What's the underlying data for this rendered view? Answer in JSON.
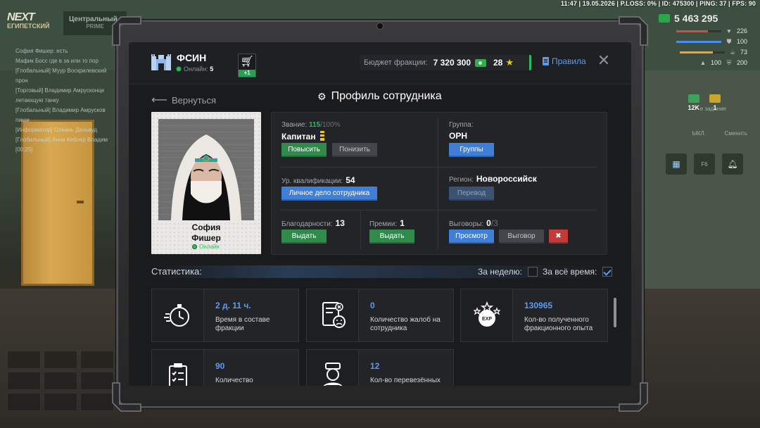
{
  "hud": {
    "top_status": "11:47 | 19.05.2026 | P.LOSS: 0% | ID: 475300 | PING: 37 | FPS: 90",
    "logo_top": "NEXT",
    "logo_sub": "ЕГИПЕТСКИЙ",
    "server_name": "Центральный",
    "server_tag": "PRIME",
    "money": "5 463 295",
    "stats": [
      {
        "value": "226",
        "fill": 0.7,
        "color": "#e0463e",
        "icon": "heart-icon"
      },
      {
        "value": "100",
        "fill": 1.0,
        "color": "#4a8df0",
        "icon": "armor-icon"
      },
      {
        "value": "73",
        "fill": 0.73,
        "color": "#f0a13a",
        "icon": "food-icon"
      },
      {
        "value": "100",
        "fill": 1.0,
        "color": "#9a9a9a",
        "icon": "wanted-icon"
      },
      {
        "value": "200",
        "fill": 1.0,
        "color": "#9a9a9a",
        "icon": "shield-icon"
      }
    ],
    "task_text": "е задание",
    "mini_cash_a": "12K",
    "mini_cash_b": "1",
    "swap_left": "ЫКЛ.",
    "swap_right": "Сменить",
    "chat_lines": [
      "София Фишер: есть",
      "Мафик Босс где в за или то пор",
      "[Глобальный] Муур Воскрилевский",
      "прон",
      "[Торговый] Владимир Амрусконце",
      "летающую танку",
      "[Глобальный] Владимир Амрусков",
      "пиши",
      "[Информатор] Олеань Деньвуд",
      "[Глобальный] Анна Кеблер Владим",
      "[00:25]"
    ]
  },
  "header": {
    "faction_name": "ФСИН",
    "online_label": "Онлайн:",
    "online_count": "5",
    "cart_badge": "+1",
    "budget_label": "Бюджет фракции:",
    "budget_value": "7 320 300",
    "stars_value": "28",
    "rules_label": "Правила"
  },
  "nav": {
    "back_label": "Вернуться",
    "title": "Профиль сотрудника"
  },
  "employee": {
    "first_name": "София",
    "last_name": "Фишер",
    "status": "Онлайн"
  },
  "info": {
    "rank_label": "Звание:",
    "rank_current": "115",
    "rank_max": "/100%",
    "rank_name": "Капитан",
    "promote": "Повысить",
    "demote": "Понизить",
    "group_label": "Группа:",
    "group_value": "ОРН",
    "groups_btn": "Группы",
    "qual_label": "Ур. квалификации:",
    "qual_value": "54",
    "file_btn": "Личное дело сотрудника",
    "region_label": "Регион:",
    "region_value": "Новороссийск",
    "transfer_btn": "Перевод",
    "thanks_label": "Благодарности:",
    "thanks_value": "13",
    "thanks_btn": "Выдать",
    "bonus_label": "Премии:",
    "bonus_value": "1",
    "bonus_btn": "Выдать",
    "reprimand_label": "Выговоры:",
    "reprimand_value": "0",
    "reprimand_max": "/3",
    "view_btn": "Просмотр",
    "reprimand_btn": "Выговор"
  },
  "stats": {
    "label": "Статистика:",
    "week_label": "За неделю:",
    "all_label": "За всё время:",
    "week_checked": false,
    "all_checked": true,
    "cards": [
      {
        "value": "2 д. 11 ч.",
        "desc": "Время в составе фракции",
        "icon": "stopwatch-icon"
      },
      {
        "value": "0",
        "desc": "Количество жалоб на сотрудника",
        "icon": "complaint-icon"
      },
      {
        "value": "130965",
        "desc": "Кол-во полученного фракционного опыта",
        "icon": "exp-icon"
      },
      {
        "value": "90",
        "desc": "Количество",
        "icon": "clipboard-icon"
      },
      {
        "value": "12",
        "desc": "Кол-во перевезённых",
        "icon": "prisoner-icon"
      }
    ]
  }
}
